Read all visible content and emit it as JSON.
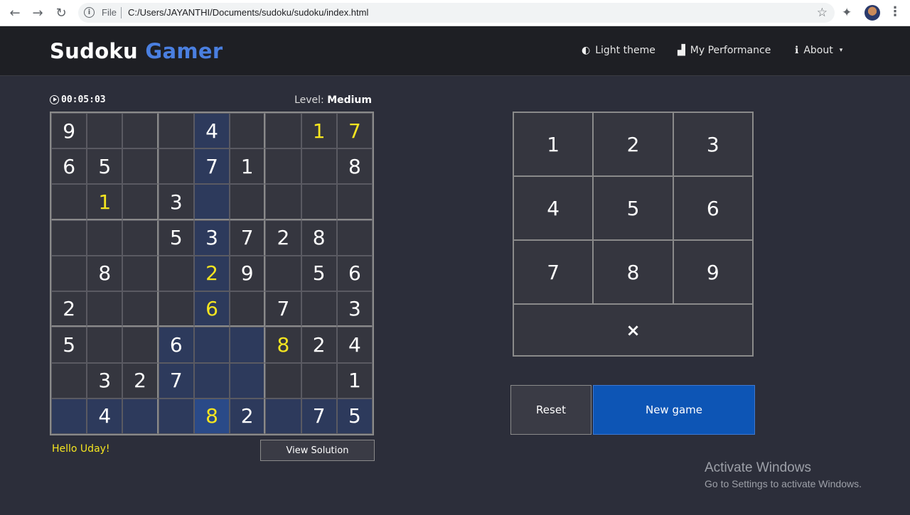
{
  "browser": {
    "scheme": "File",
    "url": "C:/Users/JAYANTHI/Documents/sudoku/sudoku/index.html",
    "back_icon": "←",
    "forward_icon": "→",
    "reload_icon": "↻",
    "info_icon": "i",
    "star_icon": "☆",
    "extensions_icon": "✦",
    "menu_icon": "⋮"
  },
  "navbar": {
    "brand_main": "Sudoku",
    "brand_accent": "Gamer",
    "brand_accent_color": "#4a7fe0",
    "links": [
      {
        "label": "Light theme",
        "icon": "◐"
      },
      {
        "label": "My Performance",
        "icon": "▟"
      },
      {
        "label": "About",
        "icon": "ℹ",
        "caret": "▾"
      }
    ]
  },
  "game": {
    "timer": "00:05:03",
    "level_label": "Level:",
    "level_value": "Medium",
    "board": [
      [
        "9",
        "",
        "",
        "",
        "4",
        "",
        "",
        "1",
        "7"
      ],
      [
        "6",
        "5",
        "",
        "",
        "7",
        "1",
        "",
        "",
        "8"
      ],
      [
        "",
        "1",
        "",
        "3",
        "",
        "",
        "",
        "",
        ""
      ],
      [
        "",
        "",
        "",
        "5",
        "3",
        "7",
        "2",
        "8",
        ""
      ],
      [
        "",
        "8",
        "",
        "",
        "2",
        "9",
        "",
        "5",
        "6"
      ],
      [
        "2",
        "",
        "",
        "",
        "6",
        "",
        "7",
        "",
        "3"
      ],
      [
        "5",
        "",
        "",
        "6",
        "",
        "",
        "8",
        "2",
        "4"
      ],
      [
        "",
        "3",
        "2",
        "7",
        "",
        "",
        "",
        "",
        "1"
      ],
      [
        "",
        "4",
        "",
        "",
        "8",
        "2",
        "",
        "7",
        "5"
      ]
    ],
    "user_entries": [
      [
        0,
        7
      ],
      [
        0,
        8
      ],
      [
        2,
        1
      ],
      [
        4,
        4
      ],
      [
        5,
        4
      ],
      [
        6,
        6
      ],
      [
        8,
        4
      ]
    ],
    "selected_cell": [
      8,
      4
    ],
    "greeting": "Hello Uday!",
    "view_solution_label": "View Solution"
  },
  "numpad": {
    "keys": [
      "1",
      "2",
      "3",
      "4",
      "5",
      "6",
      "7",
      "8",
      "9"
    ],
    "erase": "×"
  },
  "actions": {
    "reset_label": "Reset",
    "new_game_label": "New game"
  },
  "watermark": {
    "line1": "Activate Windows",
    "line2": "Go to Settings to activate Windows."
  },
  "colors": {
    "background": "#2c2e3a",
    "user_digit": "#f5e520",
    "highlight": "#2d3a5c",
    "selected": "#2a4a88",
    "new_game": "#0d55b5"
  }
}
